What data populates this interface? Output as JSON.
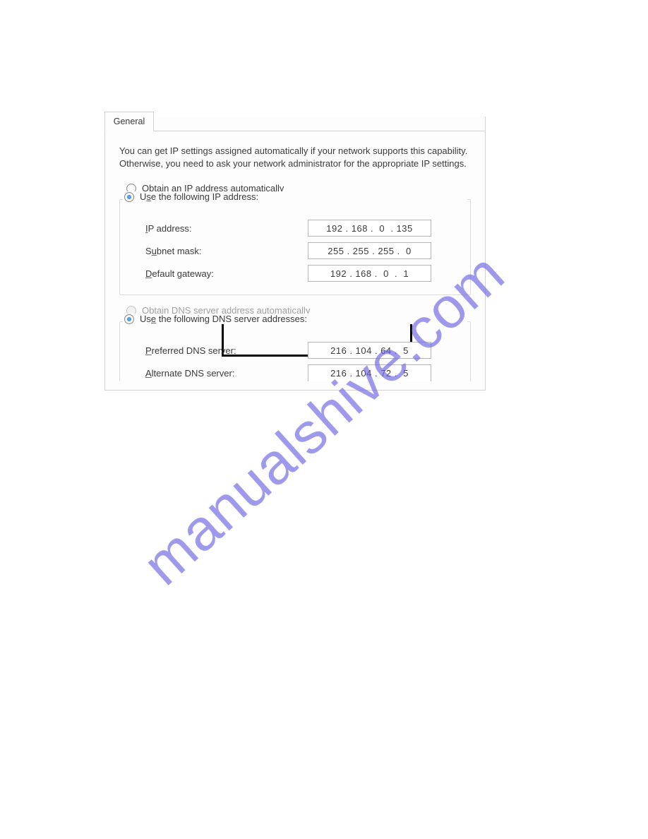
{
  "tab": {
    "label": "General"
  },
  "intro": "You can get IP settings assigned automatically if your network supports this capability. Otherwise, you need to ask your network administrator for the appropriate IP settings.",
  "ip_section": {
    "auto_label": "Obtain an IP address automatically",
    "manual_label": "Use the following IP address:",
    "fields": {
      "ip_label": "IP address:",
      "ip_value": "192 . 168 .  0  . 135",
      "subnet_label": "Subnet mask:",
      "subnet_value": "255 . 255 . 255 .  0",
      "gateway_label": "Default gateway:",
      "gateway_value": "192 . 168 .  0  .  1"
    }
  },
  "dns_section": {
    "auto_label": "Obtain DNS server address automatically",
    "manual_label": "Use the following DNS server addresses:",
    "fields": {
      "preferred_label": "Preferred DNS server:",
      "preferred_value": "216 . 104 . 64 .  5",
      "alternate_label": "Alternate DNS server:",
      "alternate_value": "216 . 104 . 72 .  5"
    }
  },
  "watermark": "manualshive.com"
}
